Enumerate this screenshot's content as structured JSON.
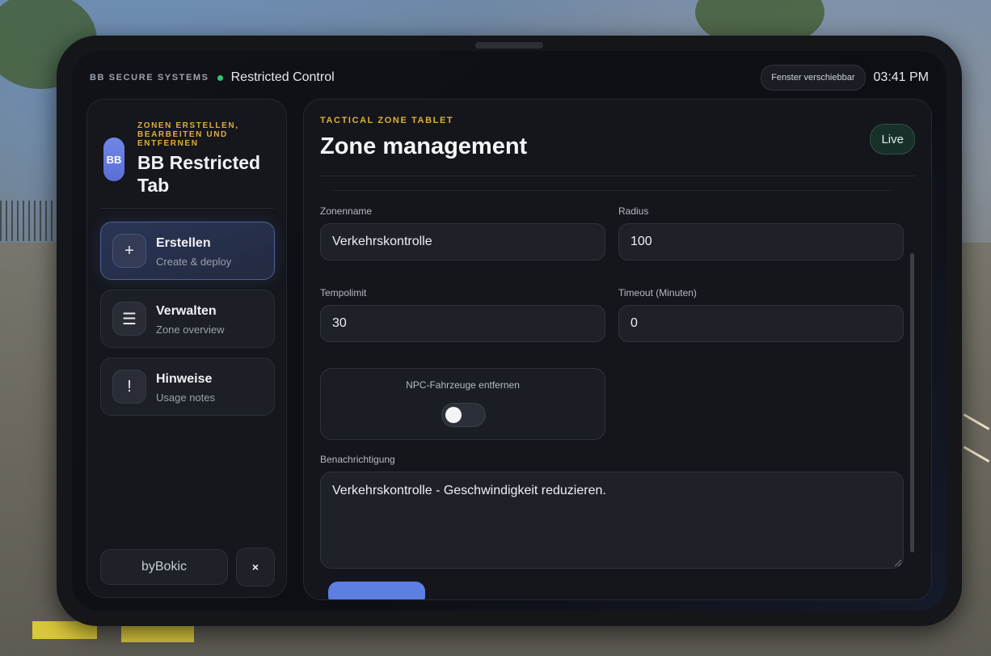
{
  "topbar": {
    "brand": "BB SECURE SYSTEMS",
    "app_title": "Restricted Control",
    "move_button": "Fenster verschiebbar",
    "time": "03:41 PM"
  },
  "sidebar": {
    "logo": "BB",
    "kicker": "ZONEN ERSTELLEN, BEARBEITEN UND ENTFERNEN",
    "title": "BB Restricted Tab",
    "items": [
      {
        "icon": "+",
        "icon_name": "plus-icon",
        "label": "Erstellen",
        "sub": "Create & deploy",
        "active": true
      },
      {
        "icon": "☰",
        "icon_name": "list-icon",
        "label": "Verwalten",
        "sub": "Zone overview",
        "active": false
      },
      {
        "icon": "!",
        "icon_name": "exclamation-icon",
        "label": "Hinweise",
        "sub": "Usage notes",
        "active": false
      }
    ],
    "author_button": "byBokic",
    "close_icon": "×"
  },
  "main": {
    "kicker": "TACTICAL ZONE TABLET",
    "title": "Zone management",
    "status": "Live",
    "fields": {
      "zonename": {
        "label": "Zonenname",
        "value": "Verkehrskontrolle"
      },
      "radius": {
        "label": "Radius",
        "value": "100"
      },
      "tempolimit": {
        "label": "Tempolimit",
        "value": "30"
      },
      "timeout": {
        "label": "Timeout (Minuten)",
        "value": "0"
      }
    },
    "npc_toggle": {
      "label": "NPC-Fahrzeuge entfernen",
      "enabled": false
    },
    "notification": {
      "label": "Benachrichtigung",
      "value": "Verkehrskontrolle - Geschwindigkeit reduzieren."
    }
  },
  "colors": {
    "accent_gold": "#e0ad3c",
    "accent_blue": "#5d7ee2",
    "status_green": "#33c46e"
  }
}
